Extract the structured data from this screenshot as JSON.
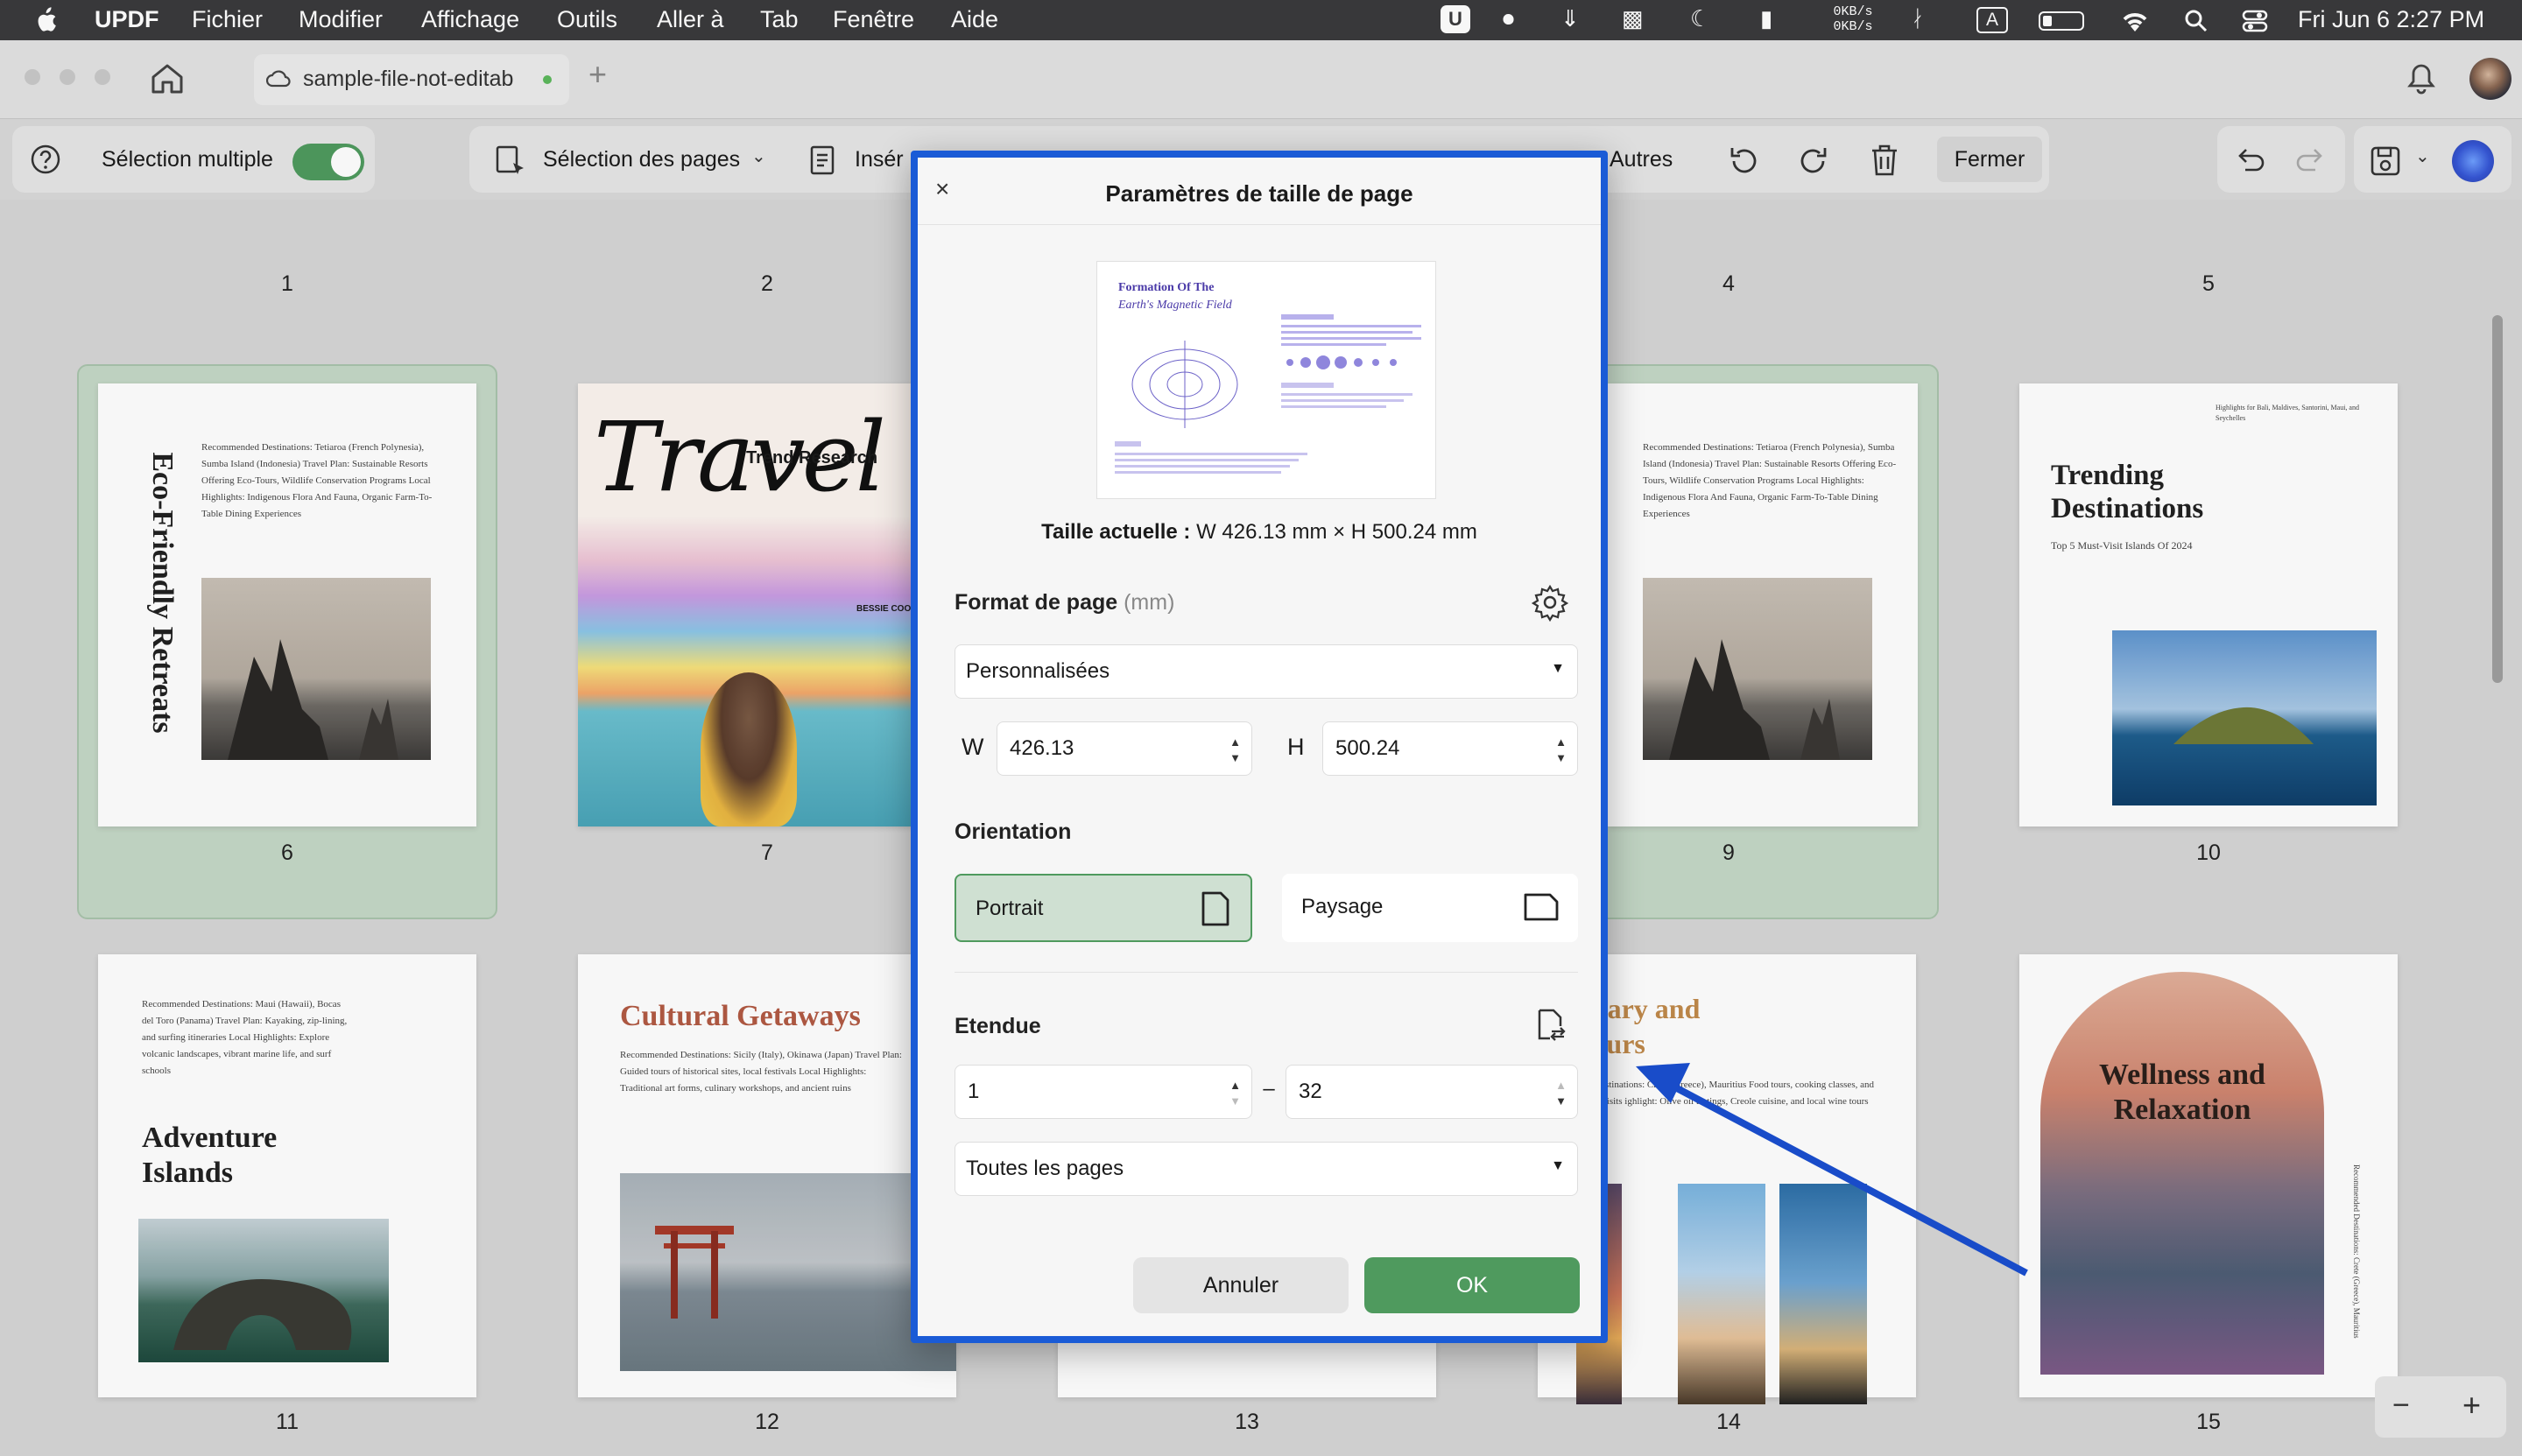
{
  "menubar": {
    "apple_icon": "apple-icon",
    "app_name": "UPDF",
    "items": [
      "Fichier",
      "Modifier",
      "Affichage",
      "Outils",
      "Aller à",
      "Tab",
      "Fenêtre",
      "Aide"
    ],
    "net_up": "0KB/s",
    "net_down": "0KB/s",
    "input_source": "A",
    "datetime": "Fri Jun 6  2:27 PM"
  },
  "tab": {
    "title": "sample-file-not-editab"
  },
  "toolbar": {
    "multi_select_label": "Sélection multiple",
    "page_select_label": "Sélection des pages",
    "insert_label": "Insér",
    "others_label": "Autres",
    "close_label": "Fermer"
  },
  "pages": {
    "row1": [
      "1",
      "2",
      "4",
      "5"
    ],
    "p6": {
      "num": "6",
      "title": "Eco-Friendly Retreats",
      "text": "Recommended Destinations: Tetiaroa (French Polynesia), Sumba Island (Indonesia) Travel Plan: Sustainable Resorts Offering Eco-Tours, Wildlife Conservation Programs Local Highlights: Indigenous Flora And Fauna, Organic Farm-To-Table Dining Experiences"
    },
    "p7": {
      "num": "7",
      "title": "Travel",
      "subtitle": "Trend Research",
      "author": "BESSIE COOP"
    },
    "p9": {
      "num": "9",
      "text": "Recommended Destinations: Tetiaroa (French Polynesia), Sumba Island (Indonesia) Travel Plan: Sustainable Resorts Offering Eco-Tours, Wildlife Conservation Programs Local Highlights: Indigenous Flora And Fauna, Organic Farm-To-Table Dining Experiences"
    },
    "p10": {
      "num": "10",
      "title": "Trending Destinations",
      "subtitle": "Top 5 Must-Visit Islands Of 2024",
      "top": "Highlights for Bali, Maldives, Santorini, Maui, and Seychelles"
    },
    "p11": {
      "num": "11",
      "title": "Adventure Islands",
      "text": "Recommended Destinations: Maui (Hawaii), Bocas del Toro (Panama) Travel Plan: Kayaking, zip-lining, and surfing itineraries Local Highlights: Explore volcanic landscapes, vibrant marine life, and surf schools"
    },
    "p12": {
      "num": "12",
      "title": "Cultural Getaways",
      "text": "Recommended Destinations: Sicily (Italy), Okinawa (Japan) Travel Plan: Guided tours of historical sites, local festivals Local Highlights: Traditional art forms, culinary workshops, and ancient ruins"
    },
    "p13": {
      "num": "13"
    },
    "p14": {
      "num": "14",
      "title": "linary and Tours",
      "text": "nded Destinations: Crete (Greece), Mauritius Food tours, cooking classes, and market visits ighlight: Olive oil tastings, Creole cuisine, and local wine tours"
    },
    "p15": {
      "num": "15",
      "title": "Wellness and Relaxation",
      "side": "Recommended Destinations: Crete (Greece), Mauritius"
    }
  },
  "thumb": {
    "title1": "Formation Of The",
    "title2": "Earth's Magnetic Field"
  },
  "dialog": {
    "title": "Paramètres de taille de page",
    "current_size_label": "Taille actuelle :",
    "current_size_value": "W 426.13 mm × H 500.24 mm",
    "format_label": "Format de page",
    "format_unit": "(mm)",
    "format_value": "Personnalisées",
    "w_label": "W",
    "w_value": "426.13",
    "h_label": "H",
    "h_value": "500.24",
    "orientation_label": "Orientation",
    "portrait_label": "Portrait",
    "landscape_label": "Paysage",
    "range_label": "Etendue",
    "range_from": "1",
    "range_dash": "–",
    "range_to": "32",
    "range_pages": "Toutes les pages",
    "cancel_label": "Annuler",
    "ok_label": "OK"
  },
  "zoom": {
    "minus": "−",
    "plus": "+"
  },
  "colors": {
    "accent": "#1a5bd6",
    "ok": "#4f9a5e",
    "selected": "#c5d8c7"
  }
}
